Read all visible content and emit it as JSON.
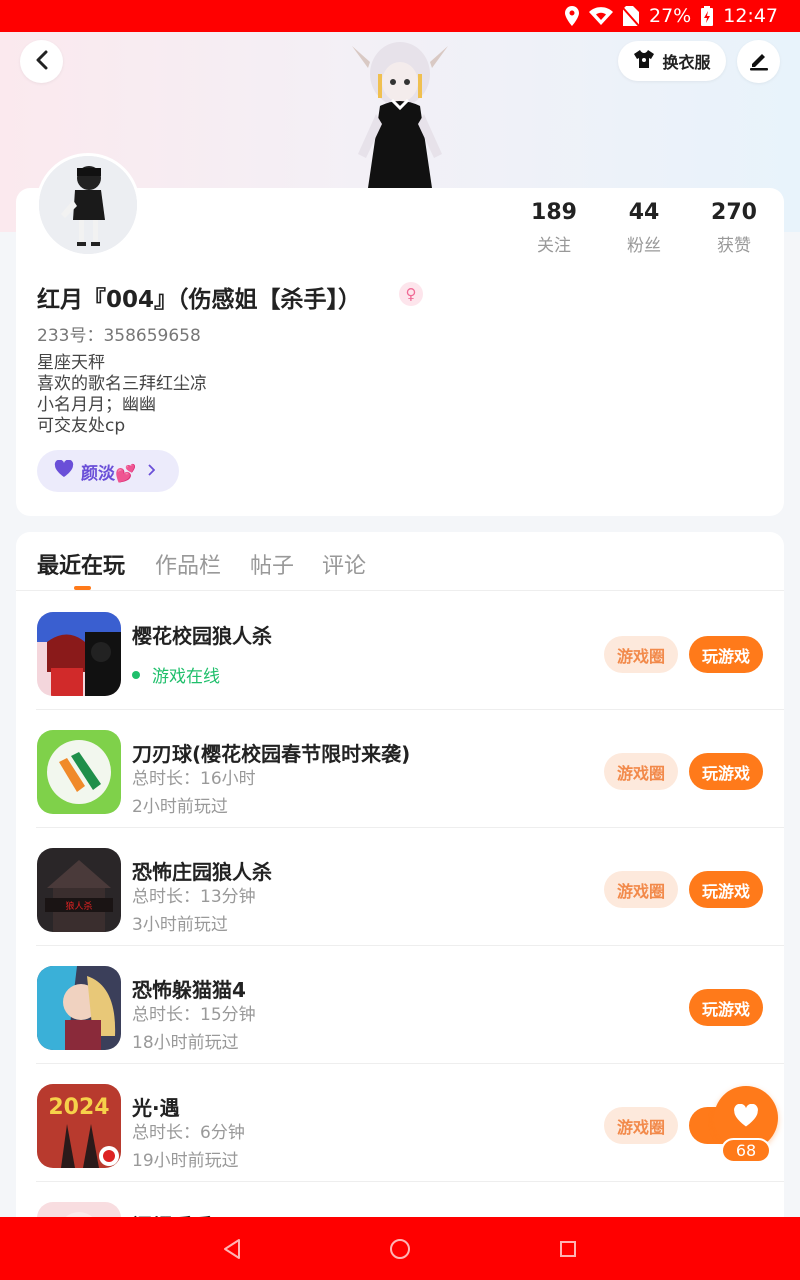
{
  "status_bar": {
    "battery": "27%",
    "time": "12:47",
    "icons": [
      "location-icon",
      "wifi-icon",
      "no-sim-icon",
      "battery-charging-icon"
    ]
  },
  "header": {
    "dress_label": "换衣服",
    "icons": [
      "back-arrow-icon",
      "tshirt-icon",
      "edit-pen-icon"
    ]
  },
  "profile": {
    "stats": [
      {
        "value": "189",
        "label": "关注"
      },
      {
        "value": "44",
        "label": "粉丝"
      },
      {
        "value": "270",
        "label": "获赞"
      }
    ],
    "username": "红月『004』（伤感姐【杀手】）",
    "gender_icon": "♀",
    "uid": "233号：358659658",
    "bio": [
      "星座天秤",
      "喜欢的歌名三拜红尘凉",
      "小名月月；幽幽",
      "可交友处cp"
    ],
    "tag_label": "颜淡💕",
    "tag_color": "#6a4fd8"
  },
  "tabs": [
    "最近在玩",
    "作品栏",
    "帖子",
    "评论"
  ],
  "games": [
    {
      "title": "樱花校园狼人杀",
      "online": "游戏在线",
      "circle_label": "游戏圈",
      "play_label": "玩游戏"
    },
    {
      "title": "刀刃球(樱花校园春节限时来袭)",
      "duration": "总时长：16小时",
      "last": "2小时前玩过",
      "circle_label": "游戏圈",
      "play_label": "玩游戏"
    },
    {
      "title": "恐怖庄园狼人杀",
      "duration": "总时长：13分钟",
      "last": "3小时前玩过",
      "circle_label": "游戏圈",
      "play_label": "玩游戏"
    },
    {
      "title": "恐怖躲猫猫4",
      "duration": "总时长：15分钟",
      "last": "18小时前玩过",
      "play_label": "玩游戏"
    },
    {
      "title": "光·遇",
      "duration": "总时长：6分钟",
      "last": "19小时前玩过",
      "circle_label": "游戏圈",
      "play_label": "玩"
    },
    {
      "title": "闪耀暖暖"
    }
  ],
  "float_like": {
    "count": "68"
  },
  "colors": {
    "accent": "#ff7a1a",
    "status_bar": "#ff0000",
    "online": "#1fbf6b"
  }
}
